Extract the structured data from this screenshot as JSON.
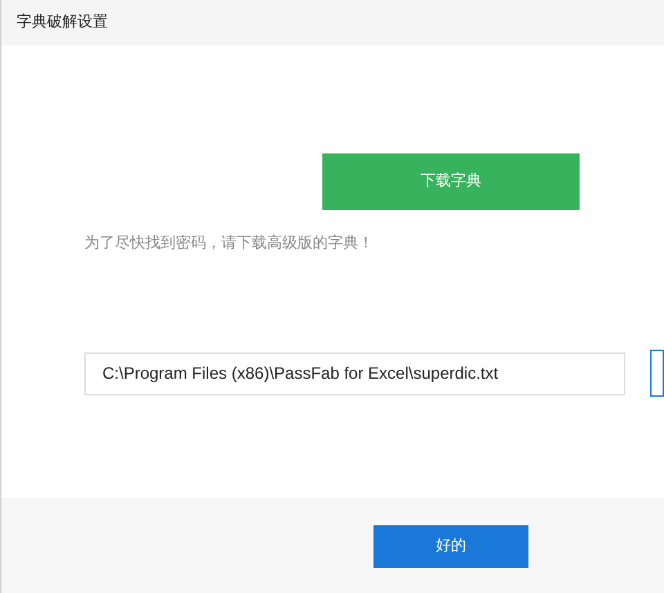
{
  "window": {
    "title": "字典破解设置"
  },
  "download_button": {
    "label": "下载字典"
  },
  "hint": "为了尽快找到密码，请下载高级版的字典！",
  "path_field": {
    "value": "C:\\Program Files (x86)\\PassFab for Excel\\superdic.txt"
  },
  "buttons": [
    {
      "label": "好的"
    }
  ]
}
